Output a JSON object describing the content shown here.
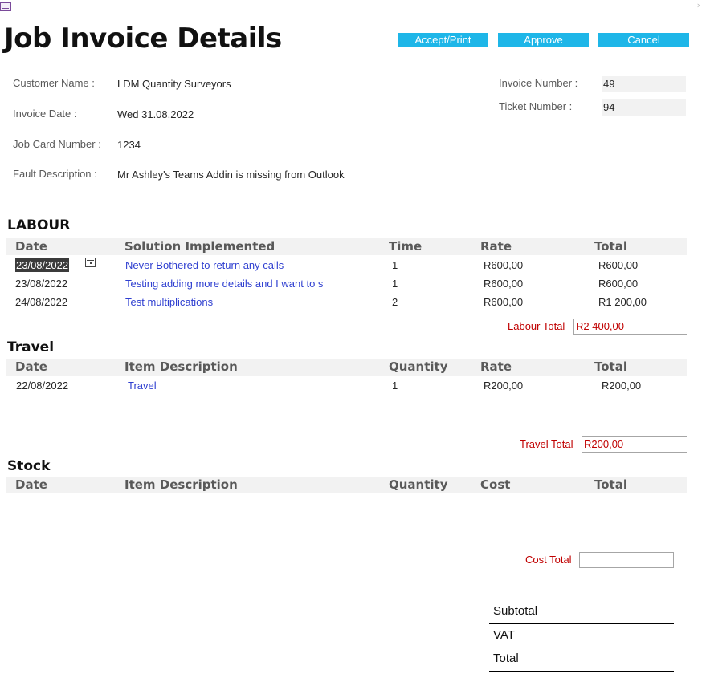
{
  "window": {
    "icon": "form-icon",
    "chevron": "›"
  },
  "title": "Job Invoice Details",
  "buttons": {
    "accept_print": "Accept/Print",
    "approve": "Approve",
    "cancel": "Cancel"
  },
  "customer": {
    "customer_name_label": "Customer Name :",
    "customer_name": "LDM Quantity Surveyors",
    "invoice_date_label": "Invoice Date :",
    "invoice_date": "Wed 31.08.2022",
    "job_card_label": "Job Card Number :",
    "job_card": "1234",
    "fault_label": "Fault Description :",
    "fault": "Mr Ashley's Teams Addin is missing from Outlook",
    "invoice_number_label": "Invoice Number :",
    "invoice_number": "49",
    "ticket_number_label": "Ticket Number :",
    "ticket_number": "94"
  },
  "labour": {
    "heading": "LABOUR",
    "columns": [
      "Date",
      "Solution Implemented",
      "Time",
      "Rate",
      "Total"
    ],
    "rows": [
      {
        "date": "23/08/2022",
        "desc": "Never Bothered to return any calls",
        "time": "1",
        "rate": "R600,00",
        "total": "R600,00"
      },
      {
        "date": "23/08/2022",
        "desc": "Testing adding more details and I want to s",
        "time": "1",
        "rate": "R600,00",
        "total": "R600,00"
      },
      {
        "date": "24/08/2022",
        "desc": "Test multiplications",
        "time": "2",
        "rate": "R600,00",
        "total": "R1 200,00"
      }
    ],
    "total_label": "Labour Total",
    "total_value": "R2 400,00"
  },
  "travel": {
    "heading": "Travel",
    "columns": [
      "Date",
      "Item Description",
      "Quantity",
      "Rate",
      "Total"
    ],
    "rows": [
      {
        "date": "22/08/2022",
        "desc": "Travel",
        "qty": "1",
        "rate": "R200,00",
        "total": "R200,00"
      }
    ],
    "total_label": "Travel Total",
    "total_value": "R200,00"
  },
  "stock": {
    "heading": "Stock",
    "columns": [
      "Date",
      "Item Description",
      "Quantity",
      "Cost",
      "Total"
    ],
    "total_label": "Cost Total",
    "total_value": ""
  },
  "summary": {
    "subtotal": "Subtotal",
    "vat": "VAT",
    "total": "Total"
  }
}
